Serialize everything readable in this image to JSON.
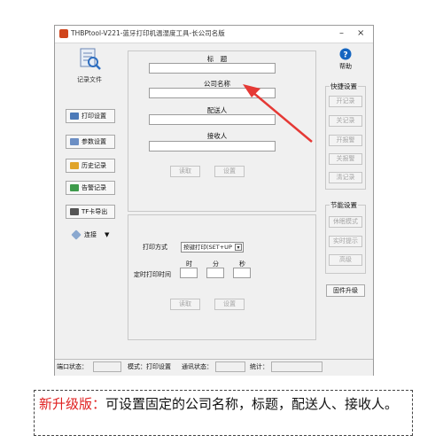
{
  "window": {
    "title": "THBPtool-V221-蓝牙打印机温湿度工具-长公司名版",
    "minimize_glyph": "–",
    "close_glyph": "×"
  },
  "sidebar": {
    "record_file_label": "记录文件",
    "buttons": [
      {
        "label": "打印设置",
        "icon": "printer-settings-icon"
      },
      {
        "label": "参数设置",
        "icon": "params-icon"
      },
      {
        "label": "历史记录",
        "icon": "history-icon"
      },
      {
        "label": "告警记录",
        "icon": "alarm-icon"
      },
      {
        "label": "TF卡导出",
        "icon": "tf-card-icon"
      },
      {
        "label": "连接",
        "icon": "connect-icon"
      }
    ]
  },
  "form": {
    "title_label": "标　题",
    "company_label": "公司名称",
    "sender_label": "配送人",
    "receiver_label": "接收人",
    "read_button": "读取",
    "set_button": "设置"
  },
  "print_settings": {
    "mode_label": "打印方式",
    "mode_value": "按键打印(SET+UP",
    "timed_label": "定时打印时间",
    "hour_label": "时",
    "minute_label": "分",
    "second_label": "秒",
    "read_button": "读取",
    "set_button": "设置"
  },
  "right_panel": {
    "help_label": "帮助",
    "quick_title": "快捷设置",
    "quick_buttons": [
      "开记录",
      "关记录",
      "开报警",
      "关报警",
      "清记录"
    ],
    "power_title": "节能设置",
    "power_buttons": [
      "休眠模式",
      "实时提示",
      "高级"
    ],
    "firmware_button": "固件升级"
  },
  "statusbar": {
    "port_label": "端口状态：",
    "mode_label": "模式：打印设置",
    "comm_label": "通讯状态：",
    "stats_label": "统计："
  },
  "caption": {
    "highlight": "新升级版：",
    "text": "可设置固定的公司名称，标题，配送人、接收人。"
  },
  "colors": {
    "accent_red": "#e02020",
    "arrow_red": "#e53935",
    "help_blue": "#1565c0"
  }
}
